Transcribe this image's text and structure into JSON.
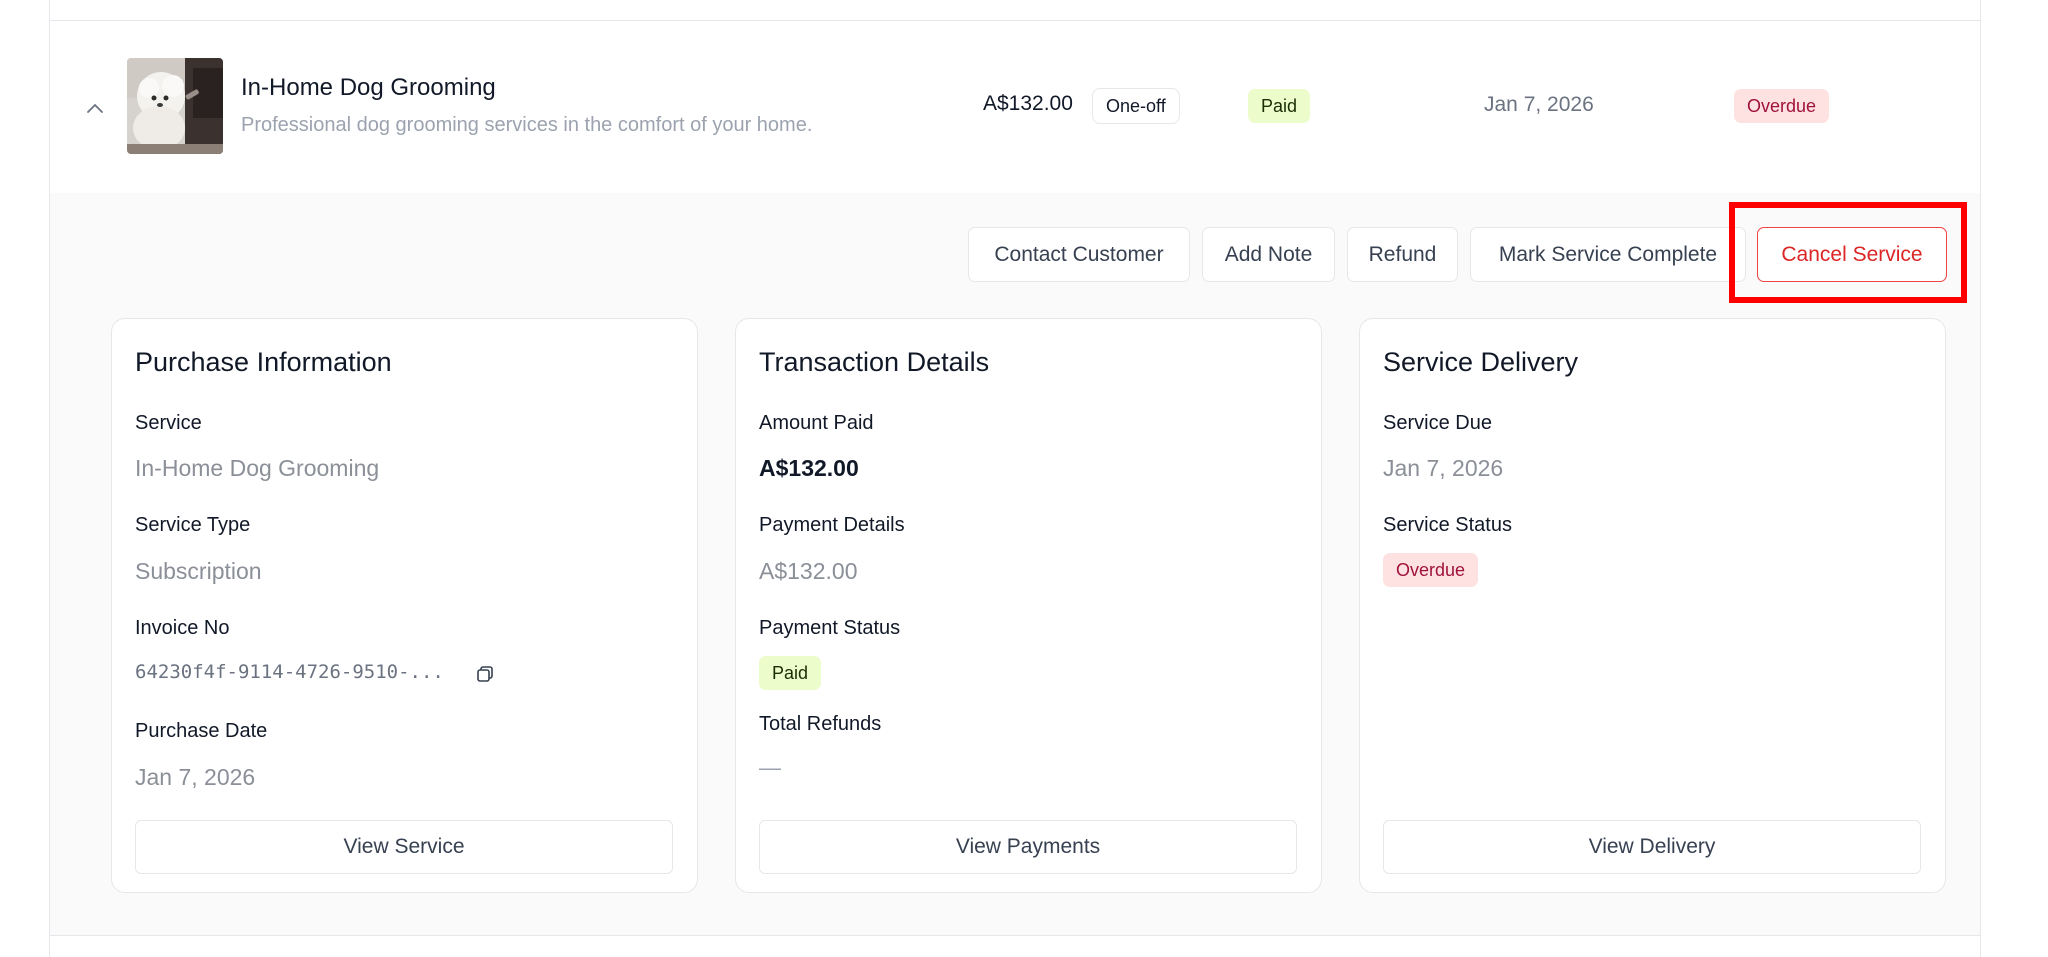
{
  "row": {
    "title": "In-Home Dog Grooming",
    "description": "Professional dog grooming services in the comfort of your home.",
    "price": "A$132.00",
    "frequency": "One-off",
    "payment_status": "Paid",
    "date": "Jan 7, 2026",
    "service_status": "Overdue",
    "thumbnail_icon": "dog-grooming-photo",
    "toggle_icon": "chevron-up-icon"
  },
  "actions": {
    "contact": "Contact Customer",
    "add_note": "Add Note",
    "refund": "Refund",
    "mark_complete": "Mark Service Complete",
    "cancel": "Cancel Service"
  },
  "purchase": {
    "title": "Purchase Information",
    "service_label": "Service",
    "service_value": "In-Home Dog Grooming",
    "type_label": "Service Type",
    "type_value": "Subscription",
    "invoice_label": "Invoice No",
    "invoice_value": "64230f4f-9114-4726-9510-...",
    "date_label": "Purchase Date",
    "date_value": "Jan 7, 2026",
    "button": "View Service"
  },
  "transaction": {
    "title": "Transaction Details",
    "amount_label": "Amount Paid",
    "amount_value": "A$132.00",
    "details_label": "Payment Details",
    "details_value": "A$132.00",
    "status_label": "Payment Status",
    "status_value": "Paid",
    "refunds_label": "Total Refunds",
    "refunds_value": "—",
    "button": "View Payments"
  },
  "delivery": {
    "title": "Service Delivery",
    "due_label": "Service Due",
    "due_value": "Jan 7, 2026",
    "status_label": "Service Status",
    "status_value": "Overdue",
    "button": "View Delivery"
  },
  "colors": {
    "highlight": "#ff0000",
    "paid_bg": "#ecfccb",
    "overdue_bg": "#fee2e2",
    "cancel_red": "#dc2626"
  }
}
